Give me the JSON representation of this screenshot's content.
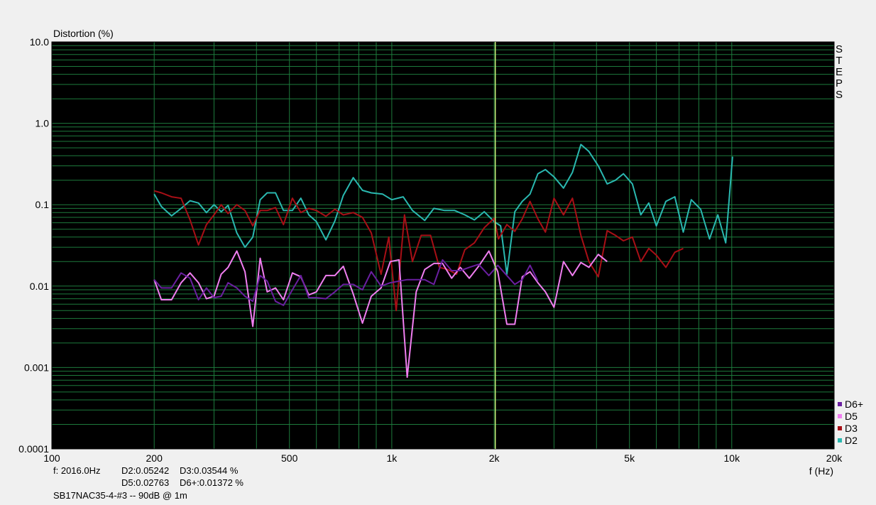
{
  "chart_data": {
    "type": "line",
    "ylabel": "Distortion (%)",
    "xlabel": "f (Hz)",
    "x_scale": "log",
    "y_scale": "log",
    "xlim": [
      100,
      20000
    ],
    "ylim": [
      0.0001,
      10
    ],
    "x_tick_labels": [
      {
        "value": 100,
        "label": "100"
      },
      {
        "value": 200,
        "label": "200"
      },
      {
        "value": 500,
        "label": "500"
      },
      {
        "value": 1000,
        "label": "1k"
      },
      {
        "value": 2000,
        "label": "2k"
      },
      {
        "value": 5000,
        "label": "5k"
      },
      {
        "value": 10000,
        "label": "10k"
      },
      {
        "value": 20000,
        "label": "20k"
      }
    ],
    "y_tick_labels": [
      {
        "value": 10,
        "label": "10.0"
      },
      {
        "value": 1,
        "label": "1.0"
      },
      {
        "value": 0.1,
        "label": "0.1"
      },
      {
        "value": 0.01,
        "label": "0.01"
      },
      {
        "value": 0.001,
        "label": "0.001"
      },
      {
        "value": 0.0001,
        "label": "0.0001"
      }
    ],
    "grid": true,
    "cursor_x": 2016,
    "side_label": "STEPS",
    "legend_position": "bottom-right",
    "series": [
      {
        "name": "D2",
        "color": "#2ab8b0",
        "points": [
          [
            200,
            0.135
          ],
          [
            210,
            0.095
          ],
          [
            225,
            0.073
          ],
          [
            240,
            0.09
          ],
          [
            255,
            0.112
          ],
          [
            270,
            0.105
          ],
          [
            285,
            0.08
          ],
          [
            300,
            0.1
          ],
          [
            315,
            0.082
          ],
          [
            330,
            0.098
          ],
          [
            350,
            0.045
          ],
          [
            370,
            0.03
          ],
          [
            390,
            0.04
          ],
          [
            410,
            0.115
          ],
          [
            430,
            0.14
          ],
          [
            455,
            0.14
          ],
          [
            480,
            0.085
          ],
          [
            510,
            0.085
          ],
          [
            540,
            0.12
          ],
          [
            570,
            0.075
          ],
          [
            600,
            0.062
          ],
          [
            640,
            0.037
          ],
          [
            680,
            0.063
          ],
          [
            720,
            0.13
          ],
          [
            770,
            0.215
          ],
          [
            820,
            0.15
          ],
          [
            870,
            0.14
          ],
          [
            940,
            0.135
          ],
          [
            1000,
            0.115
          ],
          [
            1080,
            0.125
          ],
          [
            1150,
            0.085
          ],
          [
            1250,
            0.064
          ],
          [
            1330,
            0.09
          ],
          [
            1430,
            0.085
          ],
          [
            1530,
            0.085
          ],
          [
            1640,
            0.075
          ],
          [
            1750,
            0.065
          ],
          [
            1870,
            0.082
          ],
          [
            2000,
            0.062
          ],
          [
            2090,
            0.055
          ],
          [
            2180,
            0.014
          ],
          [
            2300,
            0.082
          ],
          [
            2420,
            0.11
          ],
          [
            2550,
            0.135
          ],
          [
            2690,
            0.24
          ],
          [
            2830,
            0.27
          ],
          [
            3000,
            0.22
          ],
          [
            3200,
            0.16
          ],
          [
            3400,
            0.25
          ],
          [
            3600,
            0.55
          ],
          [
            3800,
            0.45
          ],
          [
            4050,
            0.3
          ],
          [
            4300,
            0.18
          ],
          [
            4550,
            0.2
          ],
          [
            4800,
            0.24
          ],
          [
            5100,
            0.18
          ],
          [
            5400,
            0.075
          ],
          [
            5700,
            0.105
          ],
          [
            6000,
            0.055
          ],
          [
            6400,
            0.11
          ],
          [
            6800,
            0.125
          ],
          [
            7200,
            0.046
          ],
          [
            7600,
            0.115
          ],
          [
            8100,
            0.088
          ],
          [
            8600,
            0.038
          ],
          [
            9100,
            0.075
          ],
          [
            9600,
            0.034
          ],
          [
            10050,
            0.39
          ]
        ]
      },
      {
        "name": "D3",
        "color": "#a80f16",
        "points": [
          [
            200,
            0.148
          ],
          [
            210,
            0.14
          ],
          [
            225,
            0.125
          ],
          [
            240,
            0.12
          ],
          [
            255,
            0.065
          ],
          [
            270,
            0.032
          ],
          [
            285,
            0.057
          ],
          [
            300,
            0.075
          ],
          [
            315,
            0.1
          ],
          [
            330,
            0.078
          ],
          [
            350,
            0.1
          ],
          [
            370,
            0.085
          ],
          [
            390,
            0.055
          ],
          [
            410,
            0.085
          ],
          [
            430,
            0.085
          ],
          [
            455,
            0.092
          ],
          [
            480,
            0.057
          ],
          [
            510,
            0.12
          ],
          [
            540,
            0.08
          ],
          [
            570,
            0.09
          ],
          [
            600,
            0.085
          ],
          [
            640,
            0.072
          ],
          [
            680,
            0.088
          ],
          [
            720,
            0.075
          ],
          [
            770,
            0.08
          ],
          [
            820,
            0.07
          ],
          [
            870,
            0.045
          ],
          [
            930,
            0.014
          ],
          [
            980,
            0.04
          ],
          [
            1030,
            0.005
          ],
          [
            1090,
            0.075
          ],
          [
            1150,
            0.02
          ],
          [
            1220,
            0.042
          ],
          [
            1300,
            0.042
          ],
          [
            1380,
            0.017
          ],
          [
            1460,
            0.016
          ],
          [
            1550,
            0.014
          ],
          [
            1640,
            0.028
          ],
          [
            1750,
            0.034
          ],
          [
            1870,
            0.052
          ],
          [
            2000,
            0.068
          ],
          [
            2060,
            0.038
          ],
          [
            2180,
            0.057
          ],
          [
            2300,
            0.047
          ],
          [
            2420,
            0.067
          ],
          [
            2550,
            0.11
          ],
          [
            2690,
            0.067
          ],
          [
            2830,
            0.046
          ],
          [
            3000,
            0.12
          ],
          [
            3200,
            0.075
          ],
          [
            3400,
            0.12
          ],
          [
            3600,
            0.042
          ],
          [
            3800,
            0.02
          ],
          [
            4050,
            0.013
          ],
          [
            4300,
            0.048
          ],
          [
            4550,
            0.042
          ],
          [
            4800,
            0.036
          ],
          [
            5100,
            0.04
          ],
          [
            5400,
            0.02
          ],
          [
            5700,
            0.029
          ],
          [
            6000,
            0.024
          ],
          [
            6400,
            0.017
          ],
          [
            6800,
            0.026
          ],
          [
            7200,
            0.029
          ]
        ]
      },
      {
        "name": "D5",
        "color": "#f07ef0",
        "points": [
          [
            200,
            0.012
          ],
          [
            210,
            0.0068
          ],
          [
            225,
            0.0068
          ],
          [
            240,
            0.011
          ],
          [
            255,
            0.0145
          ],
          [
            270,
            0.011
          ],
          [
            285,
            0.007
          ],
          [
            300,
            0.0075
          ],
          [
            315,
            0.014
          ],
          [
            330,
            0.017
          ],
          [
            350,
            0.027
          ],
          [
            370,
            0.015
          ],
          [
            390,
            0.0032
          ],
          [
            410,
            0.022
          ],
          [
            430,
            0.0085
          ],
          [
            455,
            0.0095
          ],
          [
            480,
            0.0068
          ],
          [
            510,
            0.0145
          ],
          [
            540,
            0.013
          ],
          [
            570,
            0.0078
          ],
          [
            600,
            0.0085
          ],
          [
            640,
            0.0135
          ],
          [
            680,
            0.0135
          ],
          [
            720,
            0.0175
          ],
          [
            770,
            0.008
          ],
          [
            820,
            0.0035
          ],
          [
            870,
            0.0075
          ],
          [
            930,
            0.0095
          ],
          [
            990,
            0.02
          ],
          [
            1050,
            0.021
          ],
          [
            1110,
            0.00076
          ],
          [
            1180,
            0.0085
          ],
          [
            1250,
            0.016
          ],
          [
            1330,
            0.019
          ],
          [
            1410,
            0.019
          ],
          [
            1500,
            0.0125
          ],
          [
            1590,
            0.017
          ],
          [
            1690,
            0.0125
          ],
          [
            1800,
            0.0175
          ],
          [
            1930,
            0.027
          ],
          [
            2050,
            0.015
          ],
          [
            2180,
            0.0034
          ],
          [
            2300,
            0.0034
          ],
          [
            2420,
            0.013
          ],
          [
            2550,
            0.015
          ],
          [
            2690,
            0.011
          ],
          [
            2830,
            0.0085
          ],
          [
            3000,
            0.0055
          ],
          [
            3200,
            0.02
          ],
          [
            3400,
            0.0135
          ],
          [
            3600,
            0.0195
          ],
          [
            3800,
            0.017
          ],
          [
            4050,
            0.0245
          ],
          [
            4300,
            0.02
          ]
        ]
      },
      {
        "name": "D6+",
        "color": "#6a1fa0",
        "points": [
          [
            200,
            0.012
          ],
          [
            210,
            0.0095
          ],
          [
            225,
            0.0095
          ],
          [
            240,
            0.0145
          ],
          [
            255,
            0.0125
          ],
          [
            270,
            0.0068
          ],
          [
            285,
            0.0095
          ],
          [
            300,
            0.0072
          ],
          [
            315,
            0.0075
          ],
          [
            330,
            0.011
          ],
          [
            350,
            0.0095
          ],
          [
            370,
            0.0075
          ],
          [
            390,
            0.0065
          ],
          [
            410,
            0.0135
          ],
          [
            430,
            0.0115
          ],
          [
            455,
            0.0065
          ],
          [
            480,
            0.0058
          ],
          [
            510,
            0.009
          ],
          [
            540,
            0.0135
          ],
          [
            570,
            0.0072
          ],
          [
            600,
            0.0072
          ],
          [
            640,
            0.007
          ],
          [
            680,
            0.0085
          ],
          [
            720,
            0.0105
          ],
          [
            770,
            0.0105
          ],
          [
            820,
            0.009
          ],
          [
            870,
            0.015
          ],
          [
            930,
            0.01
          ],
          [
            990,
            0.011
          ],
          [
            1050,
            0.0115
          ],
          [
            1110,
            0.012
          ],
          [
            1180,
            0.012
          ],
          [
            1250,
            0.012
          ],
          [
            1330,
            0.0105
          ],
          [
            1410,
            0.021
          ],
          [
            1500,
            0.0155
          ],
          [
            1590,
            0.0155
          ],
          [
            1690,
            0.017
          ],
          [
            1800,
            0.0185
          ],
          [
            1930,
            0.0135
          ],
          [
            2050,
            0.018
          ],
          [
            2180,
            0.0135
          ],
          [
            2300,
            0.0105
          ],
          [
            2420,
            0.012
          ],
          [
            2550,
            0.018
          ],
          [
            2690,
            0.0115
          ]
        ]
      }
    ]
  },
  "readout": {
    "frequency": "f: 2016.0Hz",
    "d2": "D2:0.05242",
    "d3": "D3:0.03544 %",
    "d5": "D5:0.02763",
    "d6": "D6+:0.01372 %",
    "title": "SB17NAC35-4-#3 -- 90dB @ 1m"
  }
}
